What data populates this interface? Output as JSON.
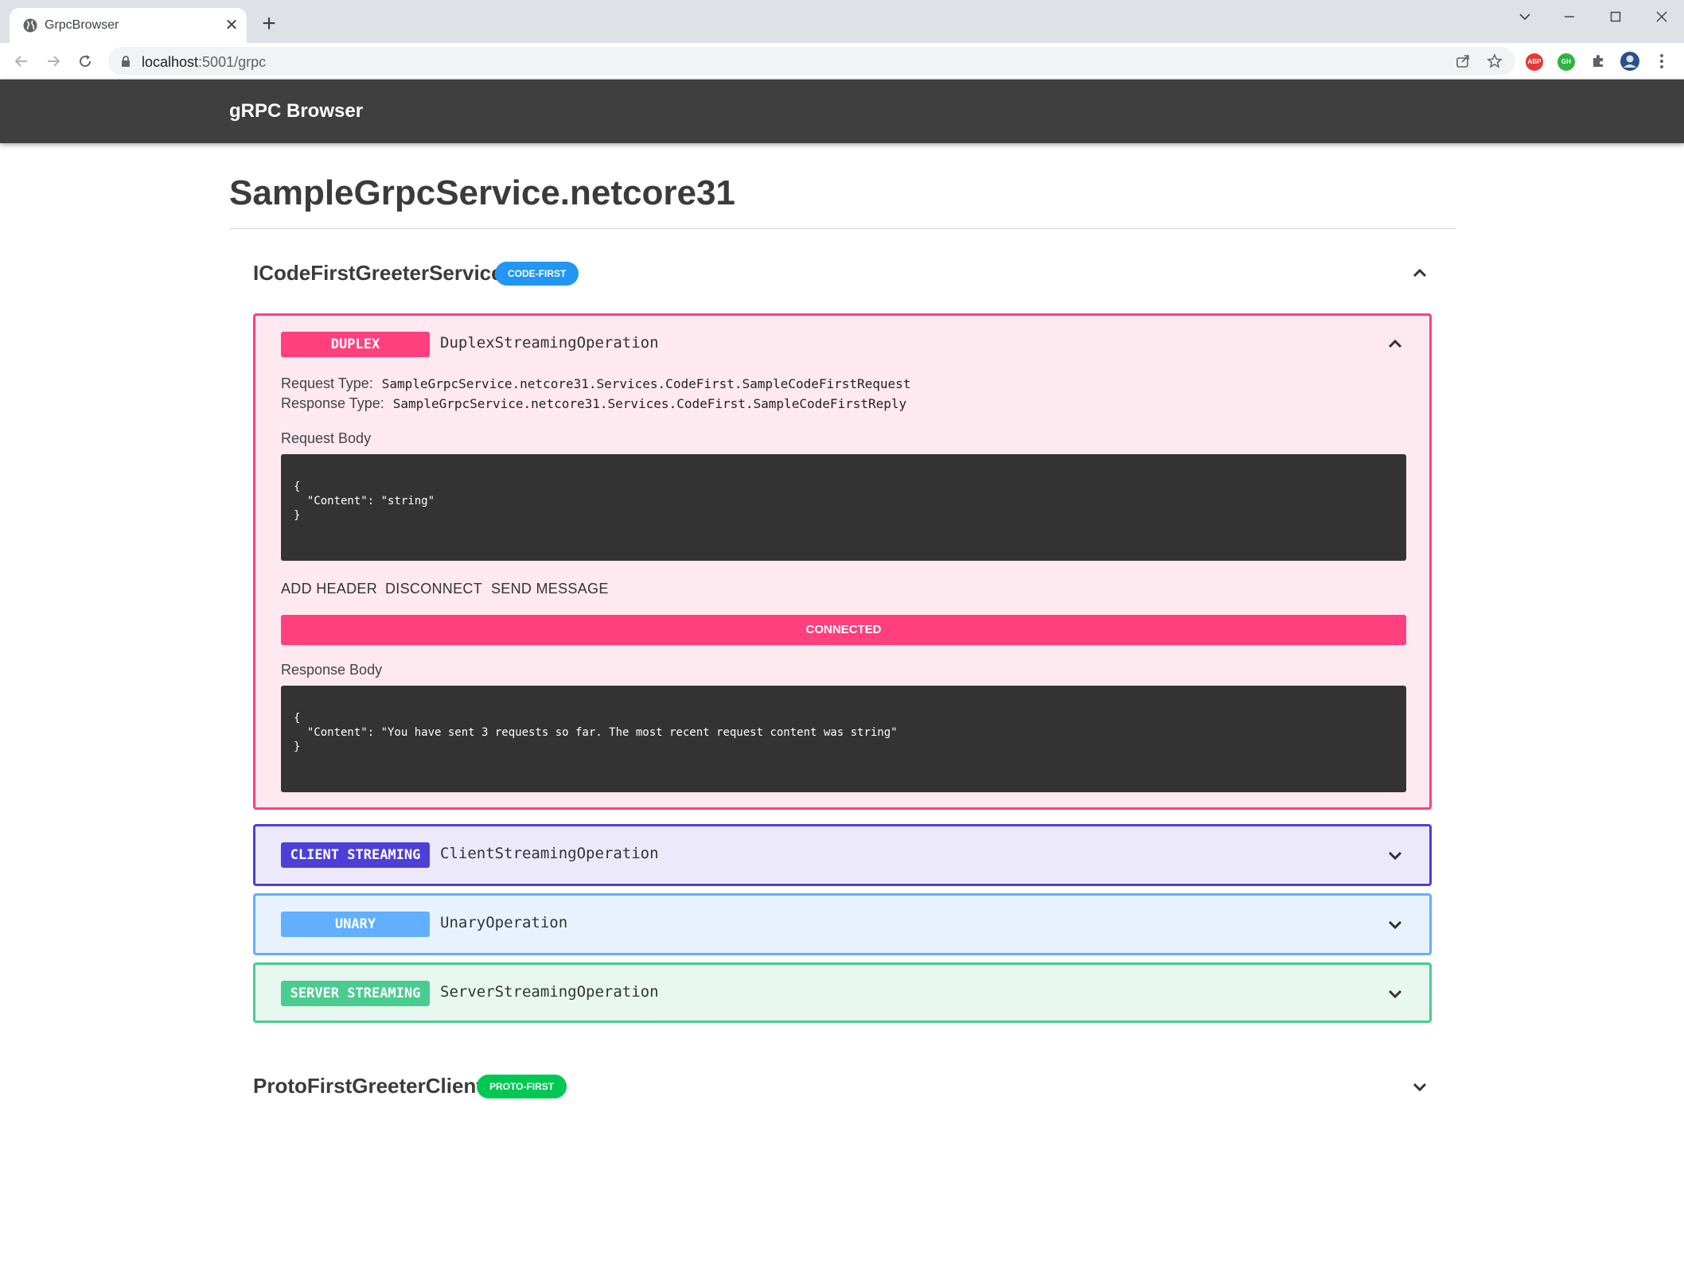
{
  "browser": {
    "tab_title": "GrpcBrowser",
    "url_host": "localhost",
    "url_path": ":5001/grpc",
    "extensions": [
      {
        "name": "abp",
        "label": "ABP",
        "color": "#e53935"
      },
      {
        "name": "green-ext",
        "label": "GH",
        "color": "#2fb344"
      }
    ]
  },
  "app": {
    "title": "gRPC Browser",
    "page_title": "SampleGrpcService.netcore31"
  },
  "services": [
    {
      "name": "ICodeFirstGreeterService",
      "badge": "CODE-FIRST",
      "badge_color": "#2196f3",
      "expanded": true,
      "operations": [
        {
          "method": "DUPLEX",
          "name": "DuplexStreamingOperation",
          "color": "#ff3f7e",
          "bg": "#fde9ef",
          "expanded": true,
          "request_type_label": "Request Type:",
          "request_type": "SampleGrpcService.netcore31.Services.CodeFirst.SampleCodeFirstRequest",
          "response_type_label": "Response Type:",
          "response_type": "SampleGrpcService.netcore31.Services.CodeFirst.SampleCodeFirstReply",
          "request_body_label": "Request Body",
          "request_body": "{\n  \"Content\": \"string\"\n}",
          "actions": [
            "ADD HEADER",
            "DISCONNECT",
            "SEND MESSAGE"
          ],
          "status": "CONNECTED",
          "response_body_label": "Response Body",
          "response_body": "{\n  \"Content\": \"You have sent 3 requests so far. The most recent request content was string\"\n}"
        },
        {
          "method": "CLIENT STREAMING",
          "name": "ClientStreamingOperation",
          "color": "#4e3fd6",
          "bg": "#ebe9fa",
          "expanded": false
        },
        {
          "method": "UNARY",
          "name": "UnaryOperation",
          "color": "#61affe",
          "bg": "#e8f2fd",
          "expanded": false
        },
        {
          "method": "SERVER STREAMING",
          "name": "ServerStreamingOperation",
          "color": "#49cc90",
          "bg": "#e8f8f0",
          "expanded": false
        }
      ]
    },
    {
      "name": "ProtoFirstGreeterClient",
      "badge": "PROTO-FIRST",
      "badge_color": "#00c853",
      "expanded": false
    }
  ]
}
